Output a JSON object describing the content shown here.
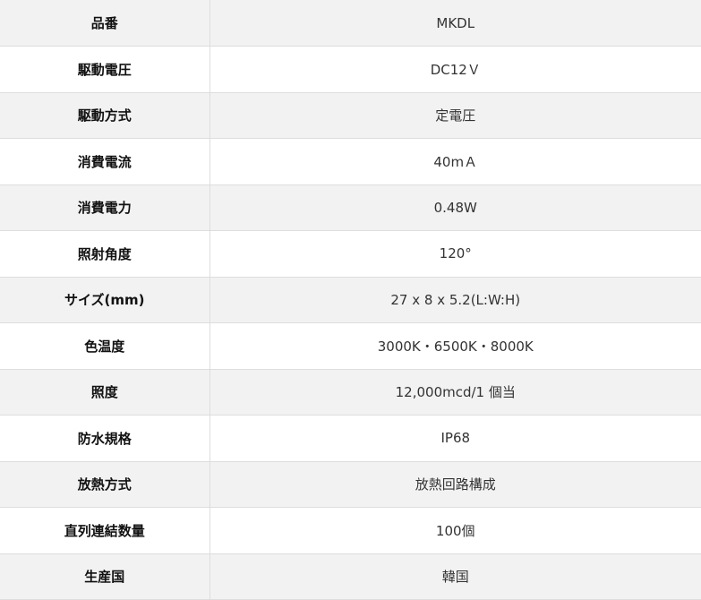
{
  "spec_table": {
    "rows": [
      {
        "label": "品番",
        "value": "MKDL"
      },
      {
        "label": "駆動電圧",
        "value": "DC12Ｖ"
      },
      {
        "label": "駆動方式",
        "value": "定電圧"
      },
      {
        "label": "消費電流",
        "value": "40mＡ"
      },
      {
        "label": "消費電力",
        "value": "0.48W"
      },
      {
        "label": "照射角度",
        "value": "120°"
      },
      {
        "label": "サイズ(mm)",
        "value": "27 x 8 x 5.2(L:W:H)"
      },
      {
        "label": "色温度",
        "value": "3000K・6500K・8000K"
      },
      {
        "label": "照度",
        "value": "12,000mcd/1 個当"
      },
      {
        "label": "防水規格",
        "value": "IP68"
      },
      {
        "label": "放熱方式",
        "value": "放熱回路構成"
      },
      {
        "label": "直列連結数量",
        "value": "100個"
      },
      {
        "label": "生産国",
        "value": "韓国"
      }
    ]
  }
}
